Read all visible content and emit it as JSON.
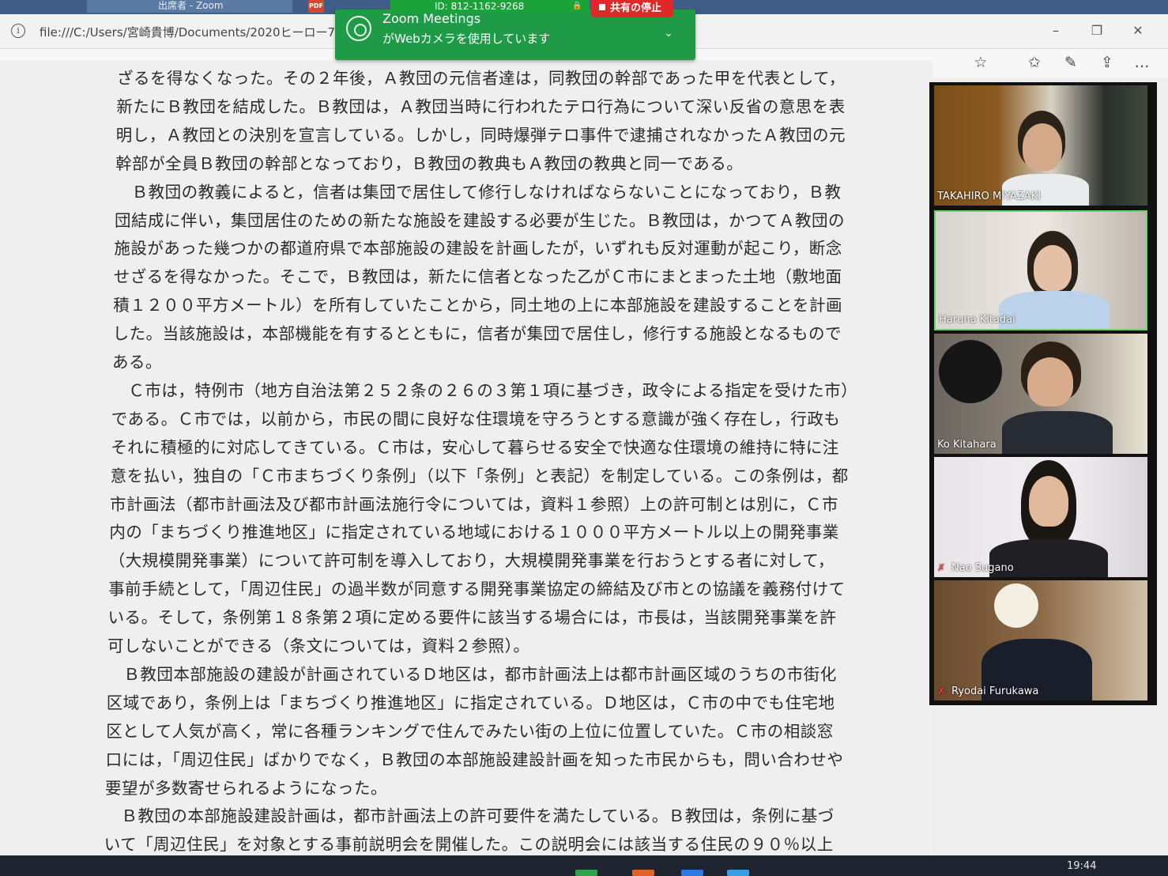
{
  "taskbar_top": {
    "zoom_window_title": "出席者 - Zoom",
    "pdf_label": "PDF"
  },
  "browser": {
    "url": "file:///C:/Users/宮崎貴博/Documents/2020ヒーロー7",
    "icons": [
      "info-icon",
      "star-icon",
      "favorites-icon",
      "pen-icon",
      "share-icon",
      "more-icon"
    ],
    "more_label": "…"
  },
  "zoom_bar": {
    "meeting_id": "ID: 812-1162-9268",
    "stop_share_label": "共有の停止"
  },
  "notification": {
    "title": "Zoom Meetings",
    "message": "がWebカメラを使用しています"
  },
  "document": {
    "lines": [
      "ざるを得なくなった。その２年後，Ａ教団の元信者達は，同教団の幹部であった甲を代表として，",
      "新たにＢ教団を結成した。Ｂ教団は，Ａ教団当時に行われたテロ行為について深い反省の意思を表",
      "明し，Ａ教団との決別を宣言している。しかし，同時爆弾テロ事件で逮捕されなかったＡ教団の元",
      "幹部が全員Ｂ教団の幹部となっており，Ｂ教団の教典もＡ教団の教典と同一である。",
      "　Ｂ教団の教義によると，信者は集団で居住して修行しなければならないことになっており，Ｂ教",
      "団結成に伴い，集団居住のための新たな施設を建設する必要が生じた。Ｂ教団は，かつてＡ教団の",
      "施設があった幾つかの都道府県で本部施設の建設を計画したが，いずれも反対運動が起こり，断念",
      "せざるを得なかった。そこで，Ｂ教団は，新たに信者となった乙がＣ市にまとまった土地（敷地面",
      "積１２００平方メートル）を所有していたことから，同土地の上に本部施設を建設することを計画",
      "した。当該施設は，本部機能を有するとともに，信者が集団で居住し，修行する施設となるもので",
      "ある。",
      "　Ｃ市は，特例市（地方自治法第２５２条の２６の３第１項に基づき，政令による指定を受けた市）",
      "である。Ｃ市では，以前から，市民の間に良好な住環境を守ろうとする意識が強く存在し，行政も",
      "それに積極的に対応してきている。Ｃ市は，安心して暮らせる安全で快適な住環境の維持に特に注",
      "意を払い，独自の「Ｃ市まちづくり条例」（以下「条例」と表記）を制定している。この条例は，都",
      "市計画法（都市計画法及び都市計画法施行令については，資料１参照）上の許可制とは別に，Ｃ市",
      "内の「まちづくり推進地区」に指定されている地域における１０００平方メートル以上の開発事業",
      "（大規模開発事業）について許可制を導入しており，大規模開発事業を行おうとする者に対して，",
      "事前手続として，「周辺住民」の過半数が同意する開発事業協定の締結及び市との協議を義務付けて",
      "いる。そして，条例第１８条第２項に定める要件に該当する場合には，市長は，当該開発事業を許",
      "可しないことができる（条文については，資料２参照）。",
      "　Ｂ教団本部施設の建設が計画されているＤ地区は，都市計画法上は都市計画区域のうちの市街化",
      "区域であり，条例上は「まちづくり推進地区」に指定されている。Ｄ地区は，Ｃ市の中でも住宅地",
      "区として人気が高く，常に各種ランキングで住んでみたい街の上位に位置していた。Ｃ市の相談窓",
      "口には，「周辺住民」ばかりでなく，Ｂ教団の本部施設建設計画を知った市民からも，問い合わせや",
      "要望が多数寄せられるようになった。",
      "　Ｂ教団の本部施設建設計画は，都市計画法上の許可要件を満たしている。Ｂ教団は，条例に基づ",
      "いて「周辺住民」を対象とする事前説明会を開催した。この説明会には該当する住民の９０％以上"
    ]
  },
  "participants": [
    {
      "name": "TAKAHIRO MIYAZAKI",
      "muted": false,
      "active": false
    },
    {
      "name": "Haruna Kitadai",
      "muted": false,
      "active": true
    },
    {
      "name": "Ko Kitahara",
      "muted": false,
      "active": false
    },
    {
      "name": "Nao Sugano",
      "muted": true,
      "active": false
    },
    {
      "name": "Ryodai Furukawa",
      "muted": true,
      "active": false
    }
  ],
  "system_tray": {
    "clock": "19:44"
  }
}
